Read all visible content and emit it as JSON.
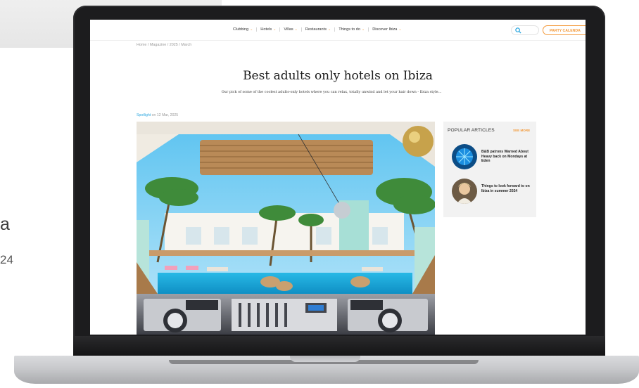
{
  "background_card": {
    "letter": "a",
    "number": "24"
  },
  "site": {
    "nav": {
      "items": [
        {
          "label": "Clubbing"
        },
        {
          "label": "Hotels"
        },
        {
          "label": "Villas"
        },
        {
          "label": "Restaurants"
        },
        {
          "label": "Things to do"
        },
        {
          "label": "Discover Ibiza"
        }
      ],
      "party_button": "PARTY CALENDA"
    },
    "breadcrumb": "Home / Magazine / 2025 / March",
    "article": {
      "title": "Best adults only hotels on Ibiza",
      "subtitle": "Our pick of some of the coolest adults-only hotels where you can relax, totally unwind and let your hair down - Ibiza style...",
      "category": "Spotlight",
      "date_prefix": " on ",
      "date": "12 Mar, 2025"
    },
    "sidebar": {
      "heading": "POPULAR ARTICLES",
      "see_more": "SEE MORE",
      "articles": [
        {
          "title": "B&B patrons Warned About Heavy back on Mondays at Eden"
        },
        {
          "title": "Things to look forward to on Ibiza in summer 2024"
        }
      ]
    },
    "colors": {
      "accent_orange": "#f39a3b",
      "accent_blue": "#2ea8e0"
    }
  }
}
